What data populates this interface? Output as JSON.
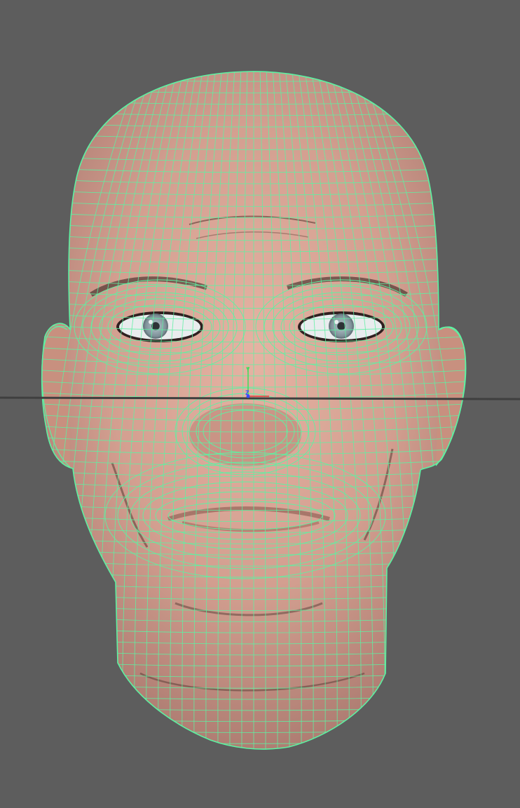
{
  "viewport": {
    "background_color": "#5d5d5d",
    "wireframe_color": "#5df2a2",
    "skin_color": "#d6a392",
    "horizon_line_color": "#3f3f3f",
    "iris_color": "#8ea0a8"
  },
  "manipulator": {
    "x_label": "",
    "y_label": "Y",
    "z_label": "Z",
    "x_color": "#e23a3a",
    "y_color": "#3ddc5a",
    "z_color": "#3a4dff"
  },
  "model": {
    "icon": "head-mesh-icon"
  }
}
